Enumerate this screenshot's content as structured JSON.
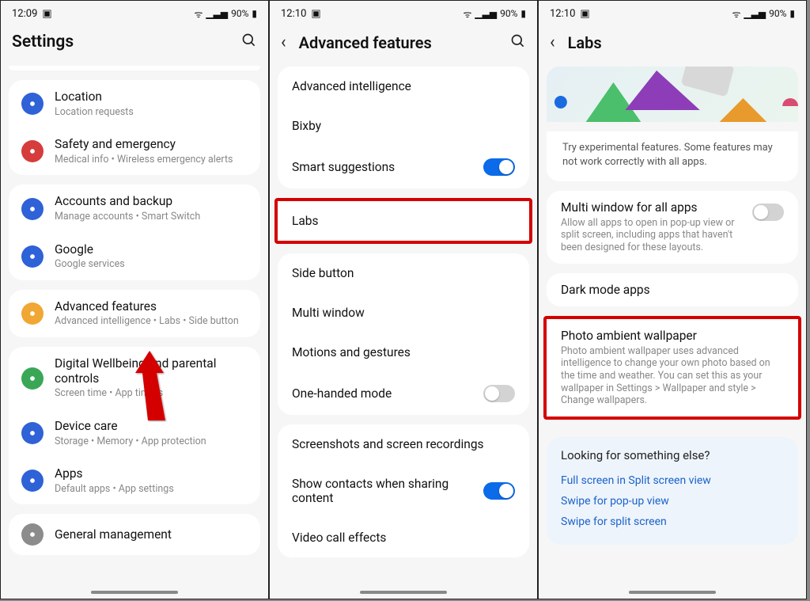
{
  "status": {
    "time1": "12:09",
    "time2": "12:10",
    "time3": "12:10",
    "battery": "90%"
  },
  "s1": {
    "title": "Settings",
    "groups": [
      [
        {
          "icon": "location-icon",
          "color": "#2e62d6",
          "title": "Location",
          "sub": "Location requests"
        },
        {
          "icon": "siren-icon",
          "color": "#d63c3c",
          "title": "Safety and emergency",
          "sub": "Medical info  •  Wireless emergency alerts"
        }
      ],
      [
        {
          "icon": "sync-icon",
          "color": "#2e62d6",
          "title": "Accounts and backup",
          "sub": "Manage accounts  •  Smart Switch"
        },
        {
          "icon": "google-icon",
          "color": "#2e62d6",
          "title": "Google",
          "sub": "Google services"
        }
      ],
      [
        {
          "icon": "gear-icon",
          "color": "#f0a733",
          "title": "Advanced features",
          "sub": "Advanced intelligence  •  Labs  •  Side button"
        }
      ],
      [
        {
          "icon": "wellbeing-icon",
          "color": "#3aa757",
          "title": "Digital Wellbeing and parental controls",
          "sub": "Screen time  •  App timers"
        },
        {
          "icon": "shield-icon",
          "color": "#2e62d6",
          "title": "Device care",
          "sub": "Storage  •  Memory  •  App protection"
        },
        {
          "icon": "apps-icon",
          "color": "#2e62d6",
          "title": "Apps",
          "sub": "Default apps  •  App settings"
        }
      ],
      [
        {
          "icon": "management-icon",
          "color": "#8c8c8c",
          "title": "General management",
          "sub": ""
        }
      ]
    ]
  },
  "s2": {
    "title": "Advanced features",
    "groups": [
      [
        {
          "label": "Advanced intelligence",
          "toggle": null
        },
        {
          "label": "Bixby",
          "toggle": null
        },
        {
          "label": "Smart suggestions",
          "toggle": true
        }
      ],
      [
        {
          "label": "Labs",
          "toggle": null,
          "highlight": true
        }
      ],
      [
        {
          "label": "Side button",
          "toggle": null
        },
        {
          "label": "Multi window",
          "toggle": null
        },
        {
          "label": "Motions and gestures",
          "toggle": null
        },
        {
          "label": "One-handed mode",
          "toggle": false
        }
      ],
      [
        {
          "label": "Screenshots and screen recordings",
          "toggle": null
        },
        {
          "label": "Show contacts when sharing content",
          "toggle": true
        },
        {
          "label": "Video call effects",
          "toggle": null
        }
      ]
    ]
  },
  "s3": {
    "title": "Labs",
    "intro": "Try experimental features. Some features may not work correctly with all apps.",
    "items": [
      {
        "title": "Multi window for all apps",
        "desc": "Allow all apps to open in pop-up view or split screen, including apps that haven't been designed for these layouts.",
        "toggle": false
      },
      {
        "title": "Dark mode apps",
        "desc": "",
        "toggle": null
      },
      {
        "title": "Photo ambient wallpaper",
        "desc": "Photo ambient wallpaper uses advanced intelligence to change your own photo based on the time and weather. You can set this as your wallpaper in Settings > Wallpaper and style > Change wallpapers.",
        "toggle": null,
        "highlight": true
      }
    ],
    "help": {
      "title": "Looking for something else?",
      "links": [
        "Full screen in Split screen view",
        "Swipe for pop-up view",
        "Swipe for split screen"
      ]
    }
  }
}
